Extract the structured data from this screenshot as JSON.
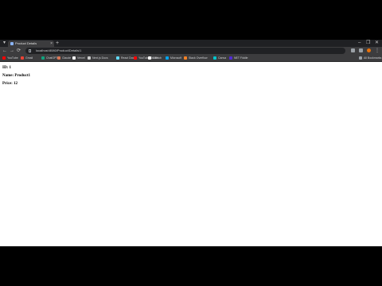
{
  "tabs": [
    {
      "title": "Product Details",
      "close": "×"
    }
  ],
  "new_tab": "+",
  "window_controls": {
    "minimize": "–",
    "maximize": "❐",
    "close": "✕"
  },
  "nav": {
    "back": "←",
    "forward": "→",
    "reload": "⟳"
  },
  "address_bar": {
    "url": "localhost:8080/Product/Details/1"
  },
  "bookmarks": [
    {
      "label": "YouTube",
      "icon": "youtube-icon",
      "color": "#ff0000"
    },
    {
      "label": "Gmail",
      "icon": "gmail-icon",
      "color": "#ea4335"
    },
    {
      "label": "ChatGPT",
      "icon": "chatgpt-icon",
      "color": "#10a37f"
    },
    {
      "label": "Claude",
      "icon": "claude-icon",
      "color": "#d97757"
    },
    {
      "label": "Vercel",
      "icon": "vercel-icon",
      "color": "#ffffff"
    },
    {
      "label": "Next.js Docs",
      "icon": "nextjs-icon",
      "color": "#cccccc"
    },
    {
      "label": "React Docs",
      "icon": "react-icon",
      "color": "#61dafb"
    },
    {
      "label": "YouTube Studio",
      "icon": "youtube-studio-icon",
      "color": "#ff0000"
    },
    {
      "label": "GitHub",
      "icon": "github-icon",
      "color": "#ffffff"
    },
    {
      "label": "Microsoft",
      "icon": "microsoft-icon",
      "color": "#00a4ef"
    },
    {
      "label": "Stack Overflow",
      "icon": "stackoverflow-icon",
      "color": "#f48024"
    },
    {
      "label": "Canva",
      "icon": "canva-icon",
      "color": "#00c4cc"
    },
    {
      "label": "NET Fiddle",
      "icon": "dotnetfiddle-icon",
      "color": "#512bd4"
    }
  ],
  "all_bookmarks": "All Bookmarks",
  "product": {
    "id_line": "ID: 1",
    "name_line": "Name: Product1",
    "price_line": "Price: 12"
  }
}
